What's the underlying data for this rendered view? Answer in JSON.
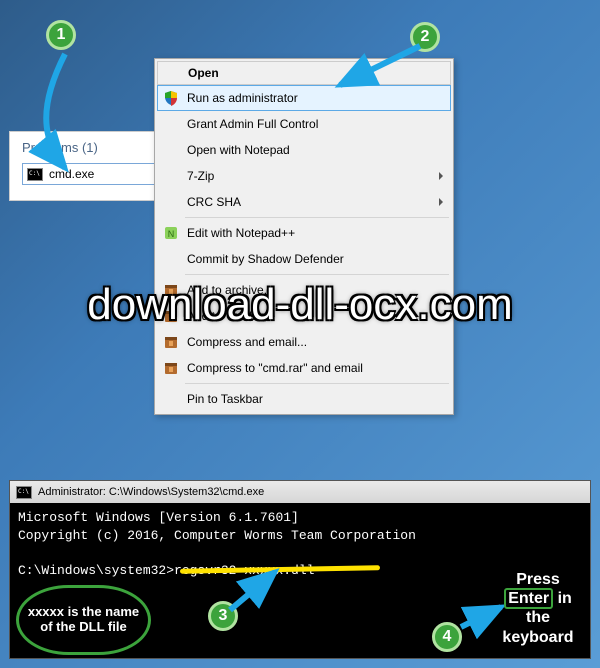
{
  "search": {
    "header": "Programs (1)",
    "result": "cmd.exe"
  },
  "context_menu": {
    "title": "Open",
    "items": [
      {
        "label": "Run as administrator",
        "icon": "shield",
        "hover": true
      },
      {
        "label": "Grant Admin Full Control"
      },
      {
        "label": "Open with Notepad"
      },
      {
        "label": "7-Zip",
        "submenu": true
      },
      {
        "label": "CRC SHA",
        "submenu": true
      },
      {
        "sep": true
      },
      {
        "label": "Edit with Notepad++",
        "icon": "notepadpp"
      },
      {
        "label": "Commit by Shadow Defender"
      },
      {
        "sep": true
      },
      {
        "label": "Add to archive...",
        "icon": "archive"
      },
      {
        "label": "Add to \"cmd.rar\"",
        "icon": "archive"
      },
      {
        "label": "Compress and email...",
        "icon": "archive"
      },
      {
        "label": "Compress to \"cmd.rar\" and email",
        "icon": "archive"
      },
      {
        "sep": true
      },
      {
        "label": "Pin to Taskbar"
      }
    ]
  },
  "watermark": "download-dll-ocx.com",
  "cmd": {
    "title": "Administrator: C:\\Windows\\System32\\cmd.exe",
    "line1": "Microsoft Windows [Version 6.1.7601]",
    "line2": "Copyright (c) 2016, Computer Worms Team Corporation",
    "prompt": "C:\\Windows\\system32>",
    "command": "regsvr32 xxxxx.dll"
  },
  "steps": {
    "1": "1",
    "2": "2",
    "3": "3",
    "4": "4"
  },
  "annotations": {
    "dll_note": "xxxxx is the name of the DLL file",
    "press": "Press",
    "enter": "Enter",
    "in_the_keyboard": "in the keyboard"
  }
}
